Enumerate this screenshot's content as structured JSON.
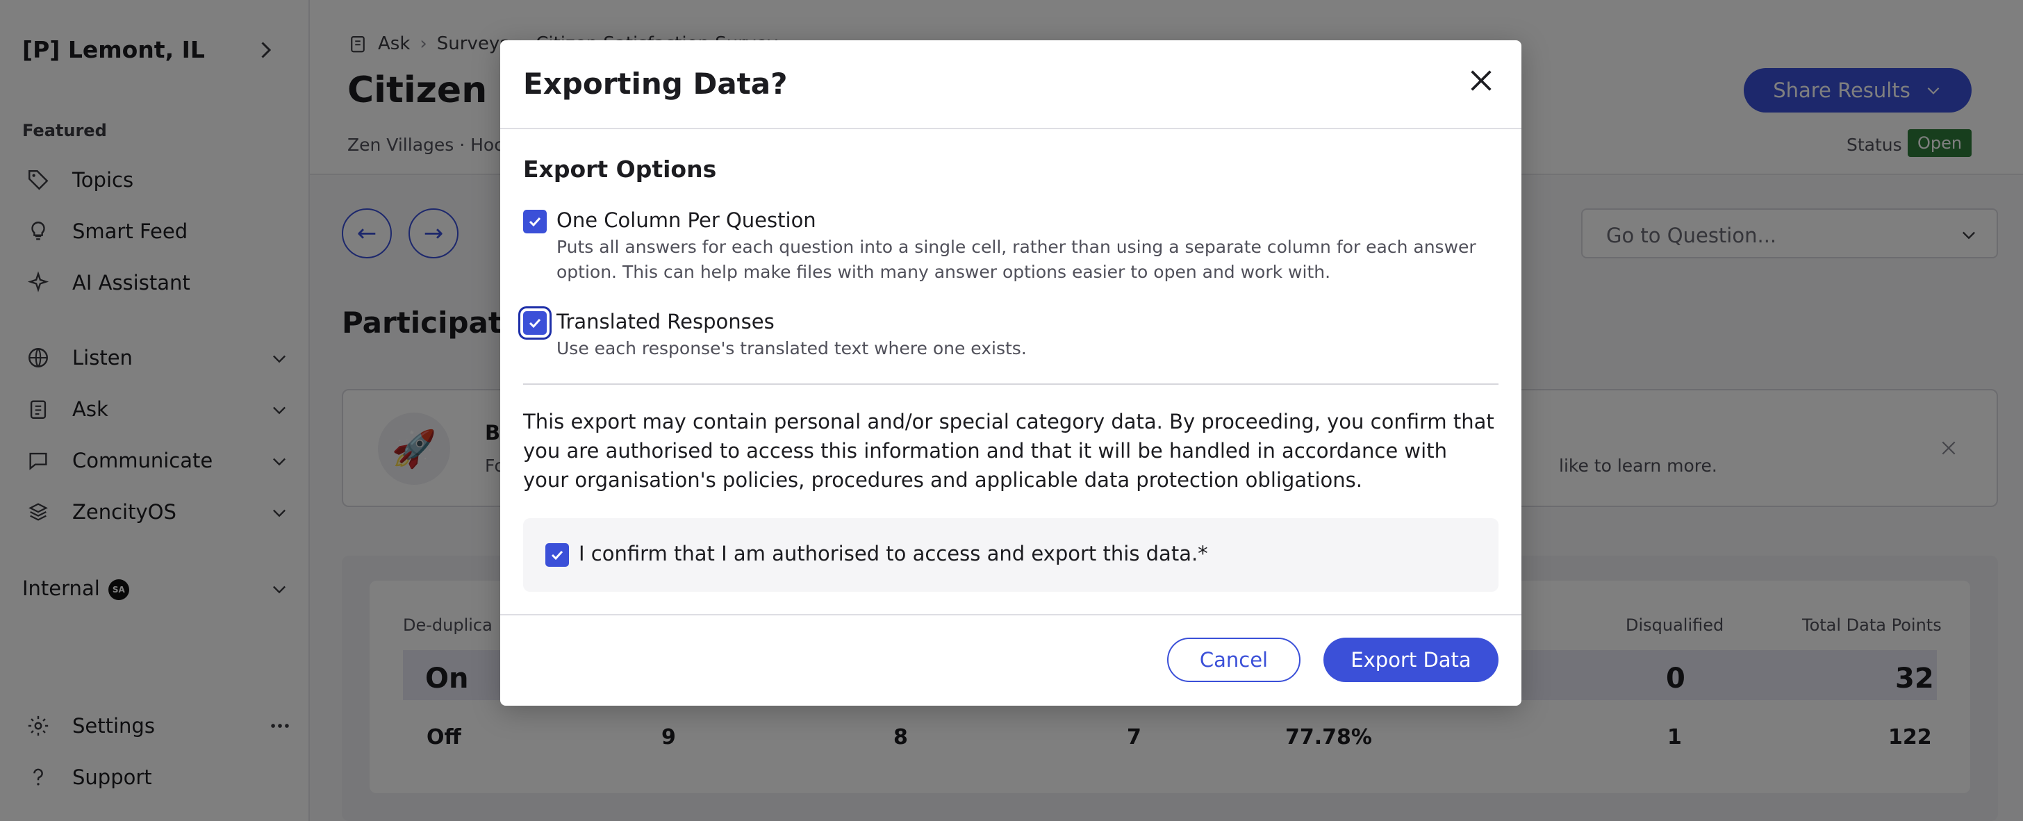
{
  "sidebar": {
    "org_name": "[P] Lemont, IL",
    "featured_label": "Featured",
    "featured_items": [
      {
        "label": "Topics",
        "icon": "tag-icon"
      },
      {
        "label": "Smart Feed",
        "icon": "lightbulb-icon"
      },
      {
        "label": "AI Assistant",
        "icon": "sparkle-icon"
      }
    ],
    "sections": [
      {
        "label": "Listen",
        "icon": "globe-icon"
      },
      {
        "label": "Ask",
        "icon": "clipboard-icon"
      },
      {
        "label": "Communicate",
        "icon": "chat-icon"
      },
      {
        "label": "ZencityOS",
        "icon": "os-icon"
      }
    ],
    "internal_label": "Internal",
    "internal_badge": "SA",
    "settings_label": "Settings",
    "support_label": "Support"
  },
  "header": {
    "breadcrumb": [
      "Ask",
      "Surveys",
      "Citizen Satisfaction Survey"
    ],
    "title": "Citizen Satisfaction Survey",
    "meta": "Zen Villages  ·  Hoc",
    "share_label": "Share Results",
    "status_label": "Status",
    "status_value": "Open"
  },
  "main": {
    "goto_placeholder": "Go to Question...",
    "section_title": "Participation",
    "banner": {
      "title": "Bo",
      "text_left": "Fo",
      "text_right": "like to learn more."
    },
    "stats": {
      "headers": [
        "De-duplica",
        "Disqualified",
        "Total Data Points"
      ],
      "on_row": [
        "On",
        "0",
        "32"
      ],
      "off_row": [
        "Off",
        "9",
        "8",
        "7",
        "77.78%",
        "1",
        "122"
      ]
    }
  },
  "modal": {
    "title": "Exporting Data?",
    "options_heading": "Export Options",
    "options": [
      {
        "label": "One Column Per Question",
        "description": "Puts all answers for each question into a single cell, rather than using a separate column for each answer option. This can help make files with many answer options easier to open and work with.",
        "checked": true
      },
      {
        "label": "Translated Responses",
        "description": "Use each response's translated text where one exists.",
        "checked": true
      }
    ],
    "disclaimer": "This export may contain personal and/or special category data. By proceeding, you confirm that you are authorised to access this information and that it will be handled in accordance with your organisation's policies, procedures and applicable data protection obligations.",
    "confirm_label": "I confirm that I am authorised to access and export this data.*",
    "confirm_checked": true,
    "cancel_label": "Cancel",
    "export_label": "Export Data"
  },
  "colors": {
    "accent": "#3b50d8",
    "status_open": "#2e7d3a"
  }
}
